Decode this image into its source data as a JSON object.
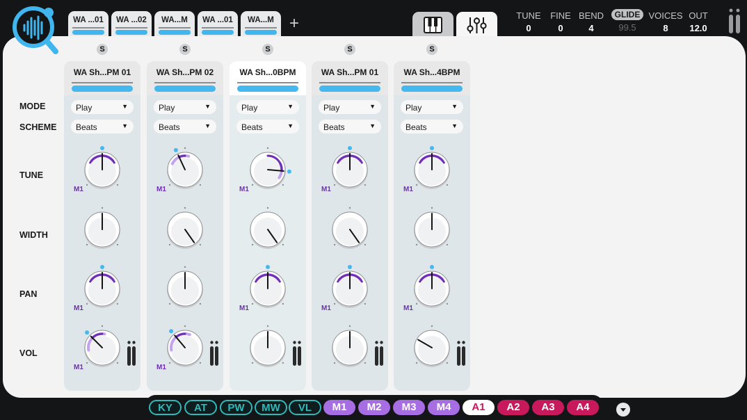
{
  "colors": {
    "accent_blue": "#45b8ef",
    "mod_purple": "#6e2fb5",
    "macro_purple": "#a76ee3",
    "aux_magenta": "#c8195c",
    "source_teal": "#2fb9b9"
  },
  "tabs": [
    {
      "label": "WA ...01"
    },
    {
      "label": "WA ...02"
    },
    {
      "label": "WA...M"
    },
    {
      "label": "WA ...01"
    },
    {
      "label": "WA...M"
    }
  ],
  "add_tab_label": "+",
  "global": {
    "tune": {
      "label": "TUNE",
      "value": "0"
    },
    "fine": {
      "label": "FINE",
      "value": "0"
    },
    "bend": {
      "label": "BEND",
      "value": "4"
    },
    "glide": {
      "label": "GLIDE",
      "value": "99.5"
    },
    "voices": {
      "label": "VOICES",
      "value": "8"
    },
    "out": {
      "label": "OUT",
      "value": "12.0"
    }
  },
  "row_labels": {
    "mode": "MODE",
    "scheme": "SCHEME",
    "tune": "TUNE",
    "width": "WIDTH",
    "pan": "PAN",
    "vol": "VOL"
  },
  "solo_label": "S",
  "columns": [
    {
      "name": "WA Sh...PM 01",
      "mode": "Play",
      "scheme": "Beats",
      "tune": {
        "angle": 0,
        "mod": "M1",
        "mod_amount": 0.5,
        "dot": true
      },
      "width": {
        "angle": 0
      },
      "pan": {
        "angle": 0,
        "mod": "M1",
        "mod_amount": 0.5,
        "dot": true
      },
      "vol": {
        "angle": -45,
        "mod": "M1",
        "mod_amount": 0.55,
        "dot": true
      }
    },
    {
      "name": "WA Sh...PM 02",
      "mode": "Play",
      "scheme": "Beats",
      "tune": {
        "angle": -25,
        "mod": "M1",
        "mod_amount": 0.4,
        "dot": true
      },
      "width": {
        "angle": 145
      },
      "pan": {
        "angle": 0
      },
      "vol": {
        "angle": -40,
        "mod": "M1",
        "mod_amount": 0.6,
        "dot": true
      }
    },
    {
      "name": "WA Sh...0BPM",
      "mode": "Play",
      "scheme": "Beats",
      "active": true,
      "tune": {
        "angle": 95,
        "mod": "M1",
        "mod_amount": 0.3,
        "dot": true
      },
      "width": {
        "angle": 145
      },
      "pan": {
        "angle": 0,
        "mod": "M1",
        "mod_amount": 0.5,
        "dot": true
      },
      "vol": {
        "angle": 0
      }
    },
    {
      "name": "WA Sh...PM 01",
      "mode": "Play",
      "scheme": "Beats",
      "tune": {
        "angle": 0,
        "mod": "M1",
        "mod_amount": 0.5,
        "dot": true
      },
      "width": {
        "angle": 145
      },
      "pan": {
        "angle": 0,
        "mod": "M1",
        "mod_amount": 0.5,
        "dot": true
      },
      "vol": {
        "angle": 0
      }
    },
    {
      "name": "WA Sh...4BPM",
      "mode": "Play",
      "scheme": "Beats",
      "tune": {
        "angle": 0,
        "mod": "M1",
        "mod_amount": 0.5,
        "dot": true
      },
      "width": {
        "angle": 0
      },
      "pan": {
        "angle": 0,
        "mod": "M1",
        "mod_amount": 0.5,
        "dot": true
      },
      "vol": {
        "angle": -60
      }
    }
  ],
  "mod_sources": [
    {
      "label": "KY",
      "kind": "src"
    },
    {
      "label": "AT",
      "kind": "src"
    },
    {
      "label": "PW",
      "kind": "src"
    },
    {
      "label": "MW",
      "kind": "src"
    },
    {
      "label": "VL",
      "kind": "src"
    },
    {
      "label": "M1",
      "kind": "macro"
    },
    {
      "label": "M2",
      "kind": "macro"
    },
    {
      "label": "M3",
      "kind": "macro"
    },
    {
      "label": "M4",
      "kind": "macro"
    },
    {
      "label": "A1",
      "kind": "aux",
      "selected": true
    },
    {
      "label": "A2",
      "kind": "aux"
    },
    {
      "label": "A3",
      "kind": "aux"
    },
    {
      "label": "A4",
      "kind": "aux"
    }
  ]
}
